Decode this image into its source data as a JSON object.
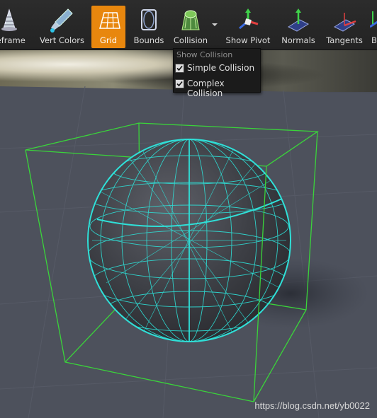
{
  "toolbar": {
    "items": [
      {
        "label": "reframe",
        "icon": "wireframe-icon",
        "active": false
      },
      {
        "label": "Vert Colors",
        "icon": "vert-colors-icon",
        "active": false
      },
      {
        "label": "Grid",
        "icon": "grid-icon",
        "active": true
      },
      {
        "label": "Bounds",
        "icon": "bounds-icon",
        "active": false
      },
      {
        "label": "Collision",
        "icon": "collision-icon",
        "active": false
      },
      {
        "label": "Show Pivot",
        "icon": "show-pivot-icon",
        "active": false
      },
      {
        "label": "Normals",
        "icon": "normals-icon",
        "active": false
      },
      {
        "label": "Tangents",
        "icon": "tangents-icon",
        "active": false
      },
      {
        "label": "B",
        "icon": "binormals-icon",
        "active": false
      }
    ],
    "active_color": "#e8870e"
  },
  "collision_menu": {
    "header": "Show Collision",
    "items": [
      {
        "label": "Simple Collision",
        "checked": true
      },
      {
        "label": "Complex Collision",
        "checked": true
      }
    ]
  },
  "viewport": {
    "wireframe_color": "#2fe0d8",
    "bounds_color": "#3ad43a"
  },
  "watermark": "https://blog.csdn.net/yb0022"
}
